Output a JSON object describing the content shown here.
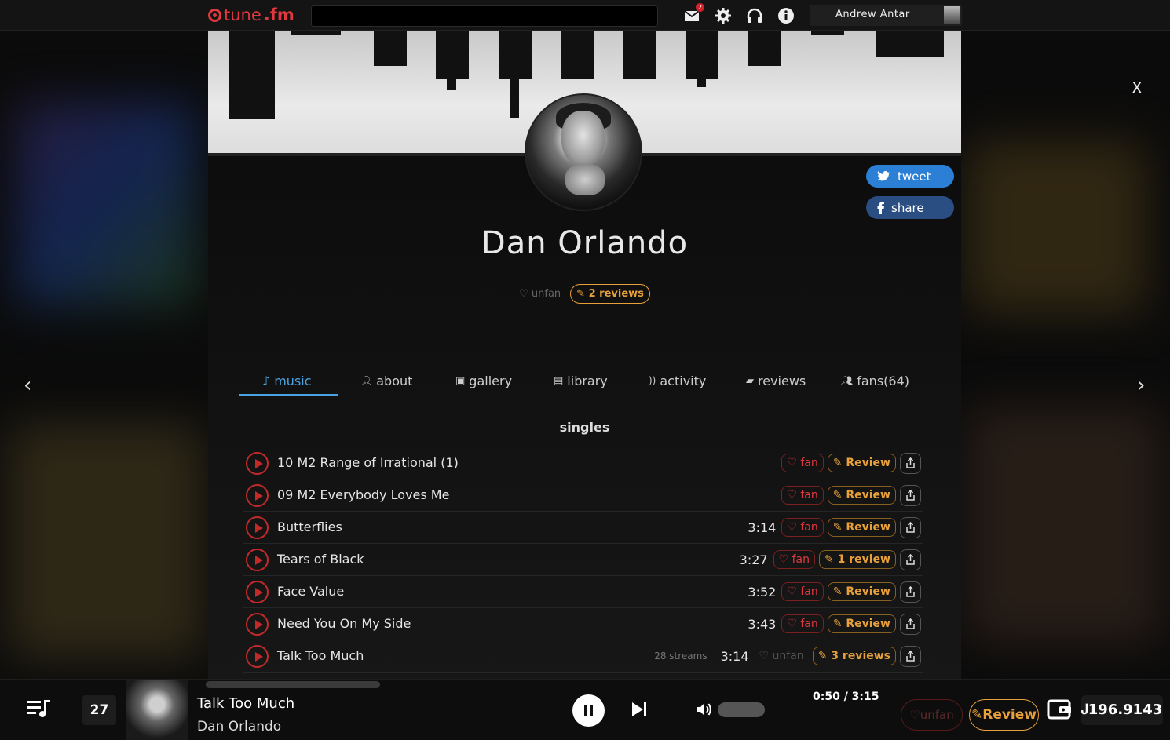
{
  "header": {
    "logo_prefix": "tune",
    "logo_suffix": ".fm",
    "search_value": "",
    "mail_count": "2",
    "user_name": "Andrew Antar"
  },
  "profile": {
    "artist_name": "Dan Orlando",
    "tweet_label": "tweet",
    "share_label": "share",
    "unfan_label": "unfan",
    "reviews_label": "2 reviews"
  },
  "tabs": [
    {
      "label": "music",
      "icon": "music-note-icon"
    },
    {
      "label": "about",
      "icon": "person-icon"
    },
    {
      "label": "gallery",
      "icon": "image-icon"
    },
    {
      "label": "library",
      "icon": "library-icon"
    },
    {
      "label": "activity",
      "icon": "rss-icon"
    },
    {
      "label": "reviews",
      "icon": "review-icon"
    },
    {
      "label": "fans(64)",
      "icon": "people-icon"
    }
  ],
  "section_title": "singles",
  "tracks": [
    {
      "title": "10 M2 Range of Irrational (1)",
      "duration": "",
      "streams": "",
      "fan": "fan",
      "review": "Review"
    },
    {
      "title": "09 M2 Everybody Loves Me",
      "duration": "",
      "streams": "",
      "fan": "fan",
      "review": "Review"
    },
    {
      "title": "Butterflies",
      "duration": "3:14",
      "streams": "",
      "fan": "fan",
      "review": "Review"
    },
    {
      "title": "Tears of Black",
      "duration": "3:27",
      "streams": "",
      "fan": "fan",
      "review": "1 review"
    },
    {
      "title": "Face Value",
      "duration": "3:52",
      "streams": "",
      "fan": "fan",
      "review": "Review"
    },
    {
      "title": "Need You On My Side",
      "duration": "3:43",
      "streams": "",
      "fan": "fan",
      "review": "Review"
    },
    {
      "title": "Talk Too Much",
      "duration": "3:14",
      "streams": "28 streams",
      "fan": "unfan",
      "review": "3 reviews"
    }
  ],
  "nav": {
    "close": "X",
    "prev": "‹",
    "next": "›"
  },
  "player": {
    "queue_count": "27",
    "title": "Talk Too Much",
    "artist": "Dan Orlando",
    "time": "0:50 / 3:15",
    "progress": 0.27,
    "unfan_label": "unfan",
    "review_label": "Review",
    "balance": "Ꭻ196.9143"
  },
  "colors": {
    "accent_red": "#e0383e",
    "accent_blue": "#4aa3e0",
    "accent_orange": "#e8a13a"
  }
}
